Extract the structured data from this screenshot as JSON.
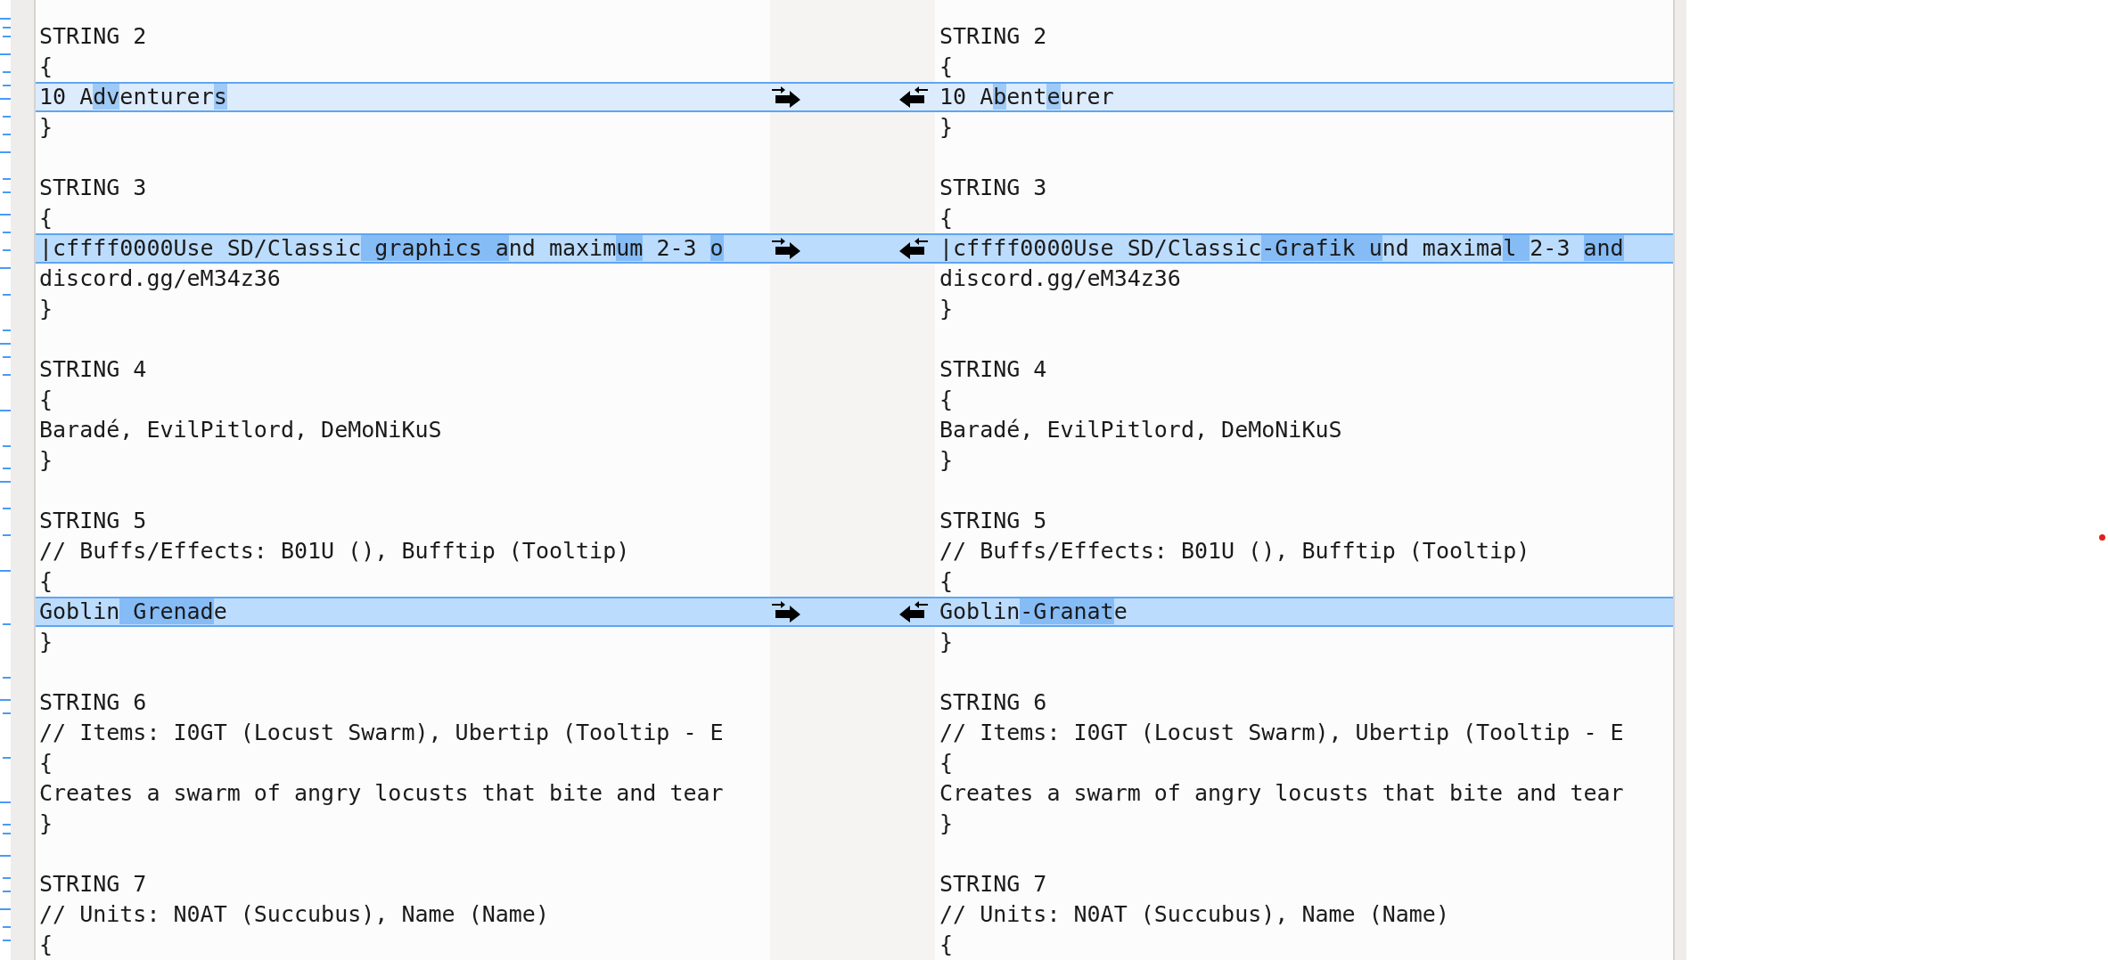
{
  "rows": [
    {
      "kind": "line",
      "left": "STRING 2",
      "right": "STRING 2"
    },
    {
      "kind": "line",
      "left": "{",
      "right": "{"
    },
    {
      "kind": "diff",
      "selected": false,
      "left": [
        {
          "text": "10 A",
          "changed": false
        },
        {
          "text": "dv",
          "changed": true
        },
        {
          "text": "enturer",
          "changed": false
        },
        {
          "text": "s",
          "changed": true
        }
      ],
      "right": [
        {
          "text": "10 A",
          "changed": false
        },
        {
          "text": "b",
          "changed": true
        },
        {
          "text": "ent",
          "changed": false
        },
        {
          "text": "e",
          "changed": true
        },
        {
          "text": "urer",
          "changed": false
        }
      ]
    },
    {
      "kind": "line",
      "left": "}",
      "right": "}"
    },
    {
      "kind": "blank"
    },
    {
      "kind": "line",
      "left": "STRING 3",
      "right": "STRING 3"
    },
    {
      "kind": "line",
      "left": "{",
      "right": "{"
    },
    {
      "kind": "diff",
      "selected": true,
      "left": [
        {
          "text": "|cffff0000Use SD/Classic",
          "changed": false
        },
        {
          "text": " graphics a",
          "changed": true
        },
        {
          "text": "nd maxim",
          "changed": false
        },
        {
          "text": "um",
          "changed": true
        },
        {
          "text": " 2-3 ",
          "changed": false
        },
        {
          "text": "o",
          "changed": true
        }
      ],
      "right": [
        {
          "text": "|cffff0000Use SD/Classic",
          "changed": false
        },
        {
          "text": "-Grafik u",
          "changed": true
        },
        {
          "text": "nd maxima",
          "changed": false
        },
        {
          "text": "l ",
          "changed": true
        },
        {
          "text": "2-3 ",
          "changed": false
        },
        {
          "text": "and",
          "changed": true
        }
      ]
    },
    {
      "kind": "line",
      "left": "discord.gg/eM34z36",
      "right": "discord.gg/eM34z36"
    },
    {
      "kind": "line",
      "left": "}",
      "right": "}"
    },
    {
      "kind": "blank"
    },
    {
      "kind": "line",
      "left": "STRING 4",
      "right": "STRING 4"
    },
    {
      "kind": "line",
      "left": "{",
      "right": "{"
    },
    {
      "kind": "line",
      "left": "Baradé, EvilPitlord, DeMoNiKuS",
      "right": "Baradé, EvilPitlord, DeMoNiKuS"
    },
    {
      "kind": "line",
      "left": "}",
      "right": "}"
    },
    {
      "kind": "blank"
    },
    {
      "kind": "line",
      "left": "STRING 5",
      "right": "STRING 5"
    },
    {
      "kind": "line",
      "left": "// Buffs/Effects: B01U (), Bufftip (Tooltip)",
      "right": "// Buffs/Effects: B01U (), Bufftip (Tooltip)"
    },
    {
      "kind": "line",
      "left": "{",
      "right": "{"
    },
    {
      "kind": "diff",
      "selected": true,
      "left": [
        {
          "text": "Goblin",
          "changed": false
        },
        {
          "text": " Grenad",
          "changed": true
        },
        {
          "text": "e",
          "changed": false
        }
      ],
      "right": [
        {
          "text": "Goblin",
          "changed": false
        },
        {
          "text": "-Granat",
          "changed": true
        },
        {
          "text": "e",
          "changed": false
        }
      ]
    },
    {
      "kind": "line",
      "left": "}",
      "right": "}"
    },
    {
      "kind": "blank"
    },
    {
      "kind": "line",
      "left": "STRING 6",
      "right": "STRING 6"
    },
    {
      "kind": "line",
      "left": "// Items: I0GT (Locust Swarm), Ubertip (Tooltip - E",
      "right": "// Items: I0GT (Locust Swarm), Ubertip (Tooltip - E"
    },
    {
      "kind": "line",
      "left": "{",
      "right": "{"
    },
    {
      "kind": "line",
      "left": "Creates a swarm of angry locusts that bite and tear",
      "right": "Creates a swarm of angry locusts that bite and tear"
    },
    {
      "kind": "line",
      "left": "}",
      "right": "}"
    },
    {
      "kind": "blank"
    },
    {
      "kind": "line",
      "left": "STRING 7",
      "right": "STRING 7"
    },
    {
      "kind": "line",
      "left": "// Units: N0AT (Succubus), Name (Name)",
      "right": "// Units: N0AT (Succubus), Name (Name)"
    },
    {
      "kind": "line",
      "left": "{",
      "right": "{"
    }
  ]
}
